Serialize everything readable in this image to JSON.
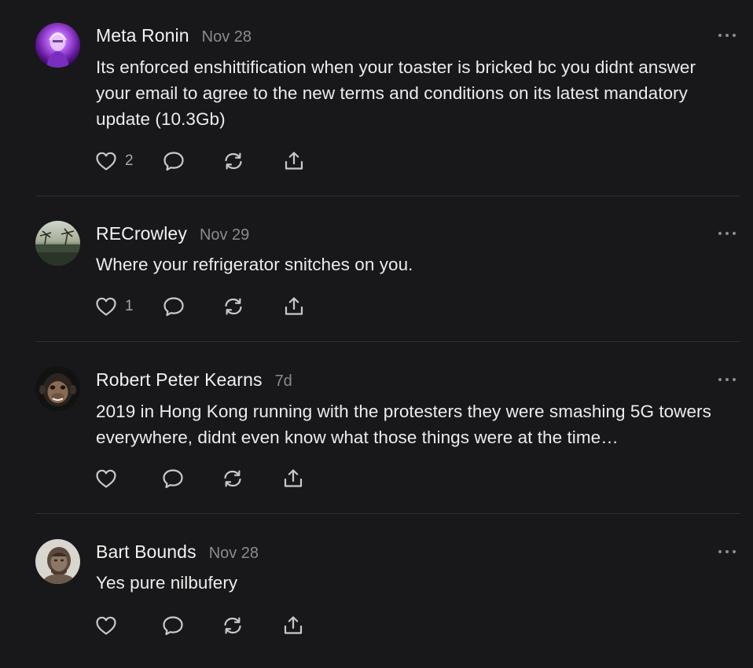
{
  "comments": [
    {
      "author": "Meta Ronin",
      "date": "Nov 28",
      "text": "Its enforced enshittification when your toaster is bricked bc you didnt answer your email to agree to the new terms and conditions on its latest mandatory update (10.3Gb)",
      "likes": "2",
      "avatar": "purple-neon-portrait"
    },
    {
      "author": "RECrowley",
      "date": "Nov 29",
      "text": "Where your refrigerator snitches on you.",
      "likes": "1",
      "avatar": "beach-palm-landscape"
    },
    {
      "author": "Robert Peter Kearns",
      "date": "7d",
      "text": "2019 in Hong Kong running with the protesters they were smashing 5G towers everywhere, didnt even know what those things were at the time…",
      "likes": "",
      "avatar": "chimpanzee-portrait"
    },
    {
      "author": "Bart Bounds",
      "date": "Nov 28",
      "text": "Yes pure nilbufery",
      "likes": "",
      "avatar": "sepia-caveman-portrait"
    }
  ],
  "icons": {
    "like": "heart-icon",
    "reply": "speech-bubble-icon",
    "restack": "refresh-arrows-icon",
    "share": "share-upload-icon",
    "more": "ellipsis-icon"
  },
  "colors": {
    "background": "#18181a",
    "text": "#ececec",
    "muted": "#8b8b8f",
    "icon": "#c9c9cc",
    "divider": "#2f2f33"
  }
}
